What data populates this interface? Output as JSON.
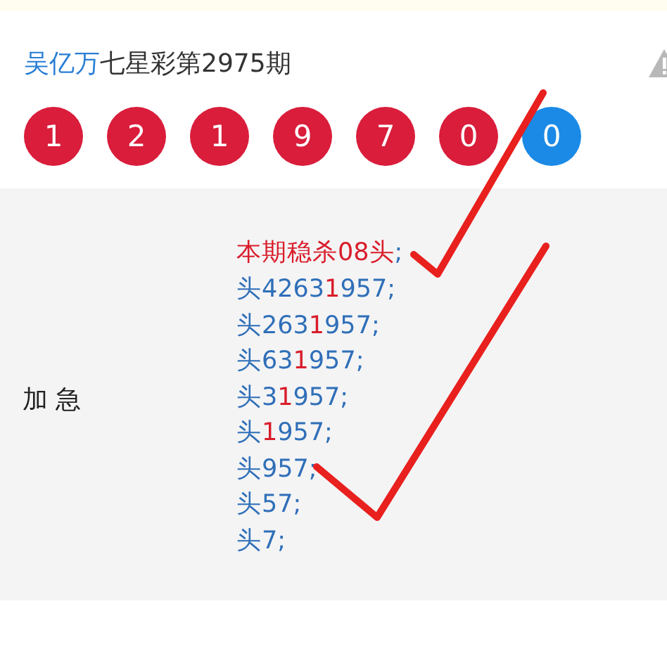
{
  "header": {
    "author": "吴亿万",
    "title": "七星彩第2975期"
  },
  "balls": [
    {
      "number": "1",
      "kind": "red"
    },
    {
      "number": "2",
      "kind": "red"
    },
    {
      "number": "1",
      "kind": "red"
    },
    {
      "number": "9",
      "kind": "red"
    },
    {
      "number": "7",
      "kind": "red"
    },
    {
      "number": "0",
      "kind": "red"
    },
    {
      "number": "0",
      "kind": "blue"
    }
  ],
  "detail": {
    "label": "加 急",
    "lines": [
      [
        {
          "text": "本期稳杀08头",
          "hit": true
        },
        {
          "text": ";",
          "hit": false
        }
      ],
      [
        {
          "text": "头4263",
          "hit": false
        },
        {
          "text": "1",
          "hit": true
        },
        {
          "text": "957;",
          "hit": false
        }
      ],
      [
        {
          "text": "头263",
          "hit": false
        },
        {
          "text": "1",
          "hit": true
        },
        {
          "text": "957;",
          "hit": false
        }
      ],
      [
        {
          "text": "头63",
          "hit": false
        },
        {
          "text": "1",
          "hit": true
        },
        {
          "text": "957;",
          "hit": false
        }
      ],
      [
        {
          "text": "头3",
          "hit": false
        },
        {
          "text": "1",
          "hit": true
        },
        {
          "text": "957;",
          "hit": false
        }
      ],
      [
        {
          "text": "头",
          "hit": false
        },
        {
          "text": "1",
          "hit": true
        },
        {
          "text": "957;",
          "hit": false
        }
      ],
      [
        {
          "text": "头957;",
          "hit": false
        }
      ],
      [
        {
          "text": "头57;",
          "hit": false
        }
      ],
      [
        {
          "text": "头7;",
          "hit": false
        }
      ]
    ]
  }
}
